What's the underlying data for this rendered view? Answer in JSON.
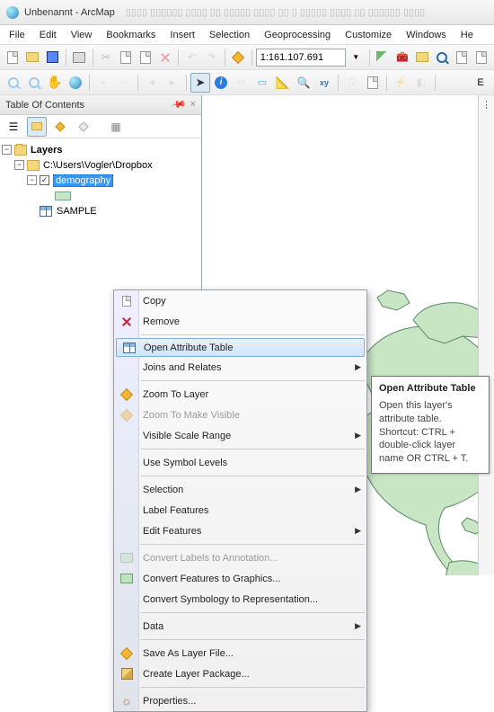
{
  "titlebar": {
    "title": "Unbenannt - ArcMap"
  },
  "menubar": [
    "File",
    "Edit",
    "View",
    "Bookmarks",
    "Insert",
    "Selection",
    "Geoprocessing",
    "Customize",
    "Windows",
    "He"
  ],
  "toolbar1": {
    "scale_value": "1:161.107.691",
    "icons": [
      "new-doc",
      "open",
      "save",
      "print",
      "cut",
      "copy",
      "paste",
      "remove",
      "undo",
      "redo"
    ]
  },
  "toolbar2": {
    "right_label": "E"
  },
  "toc": {
    "title": "Table Of Contents",
    "header_buttons": [
      "pin",
      "close"
    ],
    "layers_label": "Layers",
    "path_label": "C:\\Users\\Vogler\\Dropbox",
    "selected_layer": "demography",
    "sample_label": "SAMPLE"
  },
  "context_menu": {
    "copy": "Copy",
    "remove": "Remove",
    "open_attr": "Open Attribute Table",
    "joins": "Joins and Relates",
    "zoom_to_layer": "Zoom To Layer",
    "zoom_make_visible": "Zoom To Make Visible",
    "visible_scale_range": "Visible Scale Range",
    "use_symbol_levels": "Use Symbol Levels",
    "selection": "Selection",
    "label_features": "Label Features",
    "edit_features": "Edit Features",
    "convert_labels": "Convert Labels to Annotation...",
    "convert_features": "Convert Features to Graphics...",
    "convert_symbology": "Convert Symbology to Representation...",
    "data": "Data",
    "save_as_layer": "Save As Layer File...",
    "create_pkg": "Create Layer Package...",
    "properties": "Properties..."
  },
  "tooltip": {
    "title": "Open Attribute Table",
    "body": "Open this layer's attribute table. Shortcut: CTRL + double-click layer name OR CTRL + T."
  }
}
